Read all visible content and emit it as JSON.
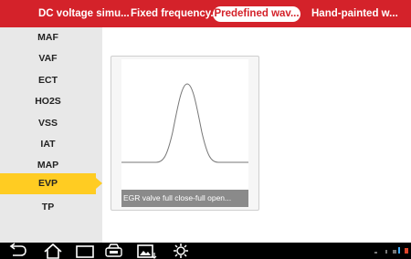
{
  "tabs": [
    {
      "label": "DC voltage simu..."
    },
    {
      "label": "Fixed frequency..."
    },
    {
      "label": "Predefined wav..."
    },
    {
      "label": "Hand-painted w..."
    }
  ],
  "sidebar": {
    "items": [
      {
        "label": "MAF"
      },
      {
        "label": "VAF"
      },
      {
        "label": "ECT"
      },
      {
        "label": "HO2S"
      },
      {
        "label": "VSS"
      },
      {
        "label": "IAT"
      },
      {
        "label": "MAP"
      },
      {
        "label": "EVP"
      },
      {
        "label": "TP"
      }
    ],
    "selected": "EVP"
  },
  "card": {
    "caption": "EGR valve full close-full open..."
  },
  "navbar": {
    "icons": [
      "back-icon",
      "home-icon",
      "recent-apps-icon",
      "vehicle-icon",
      "screenshot-icon",
      "settings-icon"
    ]
  },
  "colors": {
    "accent": "#d4222a",
    "selected": "#ffcc22",
    "sidebar_bg": "#e8e8e8"
  }
}
